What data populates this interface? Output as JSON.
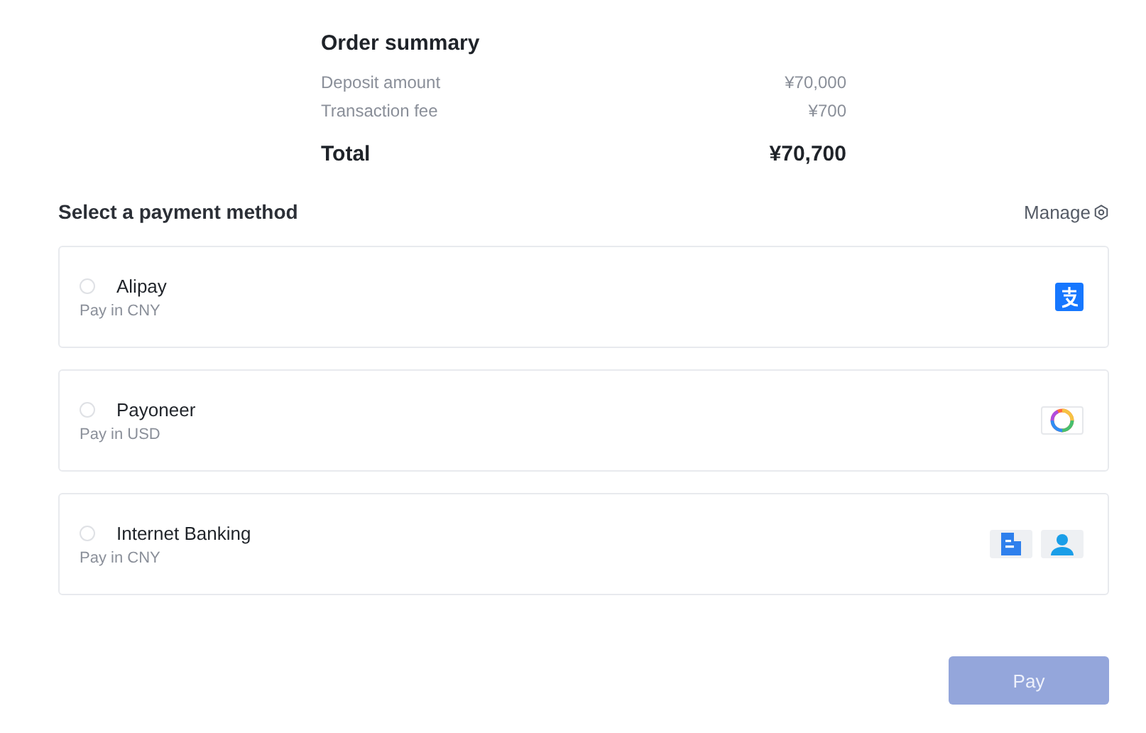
{
  "summary": {
    "title": "Order summary",
    "lines": [
      {
        "label": "Deposit amount",
        "value": "¥70,000"
      },
      {
        "label": "Transaction fee",
        "value": "¥700"
      }
    ],
    "total_label": "Total",
    "total_value": "¥70,700"
  },
  "payment": {
    "title": "Select a payment method",
    "manage": "Manage",
    "methods": [
      {
        "name": "Alipay",
        "note": "Pay in CNY",
        "selected": false,
        "kind": "alipay"
      },
      {
        "name": "Payoneer",
        "note": "Pay in USD",
        "selected": false,
        "kind": "payoneer"
      },
      {
        "name": "Internet Banking",
        "note": "Pay in CNY",
        "selected": false,
        "kind": "bank"
      }
    ]
  },
  "pay_button": {
    "label": "Pay",
    "disabled": true
  }
}
